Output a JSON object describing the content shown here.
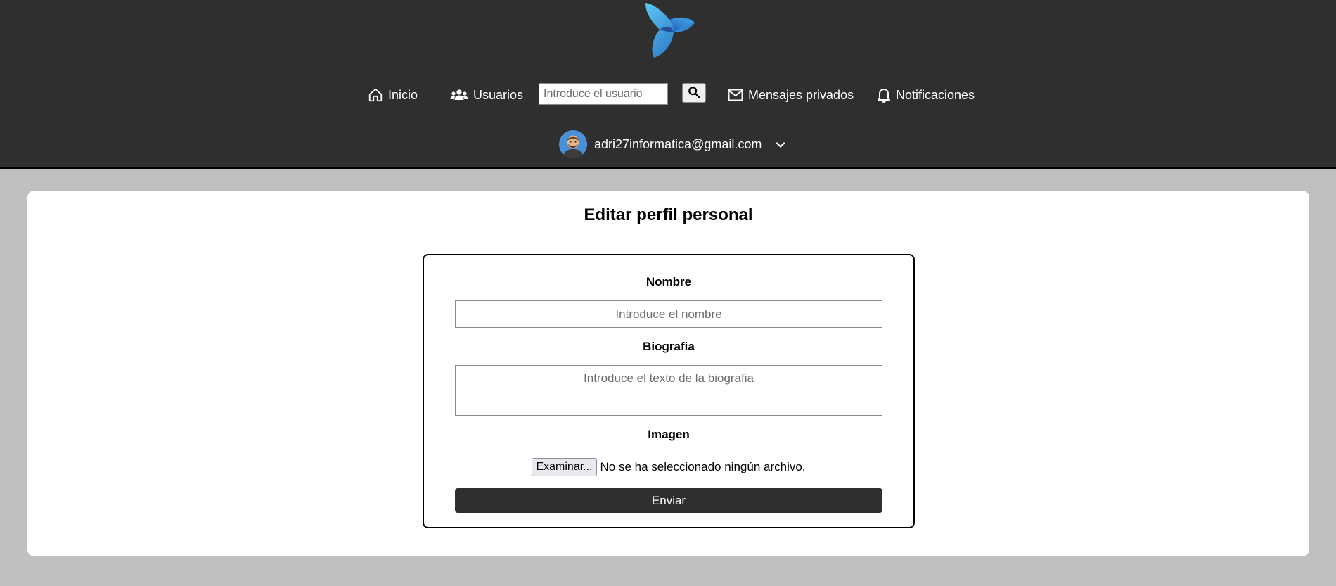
{
  "header": {
    "logo_icon": "triangle-swirl-logo",
    "nav": {
      "home_label": "Inicio",
      "users_label": "Usuarios",
      "messages_label": "Mensajes privados",
      "notifications_label": "Notificaciones"
    },
    "search": {
      "placeholder": "Introduce el usuario",
      "value": "",
      "button_icon": "search-icon"
    },
    "user": {
      "email": "adri27informatica@gmail.com",
      "avatar_icon": "user-avatar",
      "dropdown_icon": "chevron-down-icon"
    }
  },
  "main": {
    "title": "Editar perfil personal",
    "form": {
      "name_label": "Nombre",
      "name_placeholder": "Introduce el nombre",
      "name_value": "",
      "bio_label": "Biografia",
      "bio_placeholder": "Introduce el texto de la biografia",
      "bio_value": "",
      "image_label": "Imagen",
      "file_button_label": "Examinar...",
      "file_status": "No se ha seleccionado ningún archivo.",
      "submit_label": "Enviar"
    }
  },
  "colors": {
    "header_bg": "#2f2f2f",
    "page_bg": "#c0c0c0",
    "card_bg": "#ffffff",
    "submit_bg": "#2f2f2f",
    "logo_blue": "#2a8fd8"
  }
}
